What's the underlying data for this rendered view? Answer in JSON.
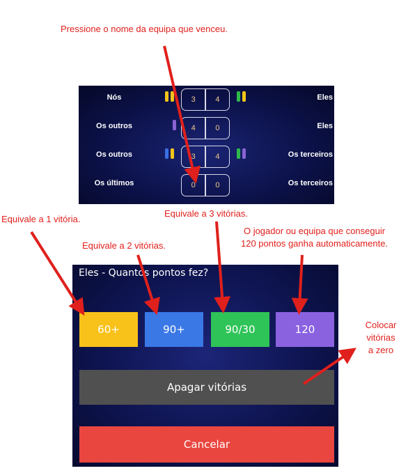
{
  "annotations": {
    "press_team": "Pressione o nome da equipa que venceu.",
    "equals_1": "Equivale a 1 vitória.",
    "equals_2": "Equivale a 2 vitórias.",
    "equals_3": "Equivale a 3 vitórias.",
    "auto_win_line1": "O jogador ou equipa que conseguir",
    "auto_win_line2": "120 pontos ganha automaticamente.",
    "reset_line1": "Colocar",
    "reset_line2": "vitórias",
    "reset_line3": "a zero"
  },
  "scoreboard": {
    "rows": [
      {
        "left_team": "Nós",
        "left_score": "3",
        "right_score": "4",
        "right_team": "Eles",
        "left_pips": [
          "#f5c518",
          "#f5c518"
        ],
        "right_pips": [
          "#2fb84c",
          "#f5c518"
        ]
      },
      {
        "left_team": "Os outros",
        "left_score": "4",
        "right_score": "0",
        "right_team": "Eles",
        "left_pips": [
          "#8a63d2"
        ],
        "right_pips": []
      },
      {
        "left_team": "Os outros",
        "left_score": "3",
        "right_score": "4",
        "right_team": "Os terceiros",
        "left_pips": [
          "#3a6fe0",
          "#f5c518"
        ],
        "right_pips": [
          "#2fb84c",
          "#8a63d2"
        ]
      },
      {
        "left_team": "Os últimos",
        "left_score": "0",
        "right_score": "0",
        "right_team": "Os terceiros",
        "left_pips": [],
        "right_pips": []
      }
    ]
  },
  "dialog": {
    "title": "Eles - Quantos pontos fez?",
    "buttons": [
      {
        "label": "60+",
        "color": "#f8c21a"
      },
      {
        "label": "90+",
        "color": "#3a78e6"
      },
      {
        "label": "90/30",
        "color": "#2fc458"
      },
      {
        "label": "120",
        "color": "#8a62e0"
      }
    ],
    "erase_label": "Apagar vitórias",
    "cancel_label": "Cancelar"
  },
  "colors": {
    "annotation": "#e0201c",
    "erase": "#505050",
    "cancel": "#ea4640"
  }
}
